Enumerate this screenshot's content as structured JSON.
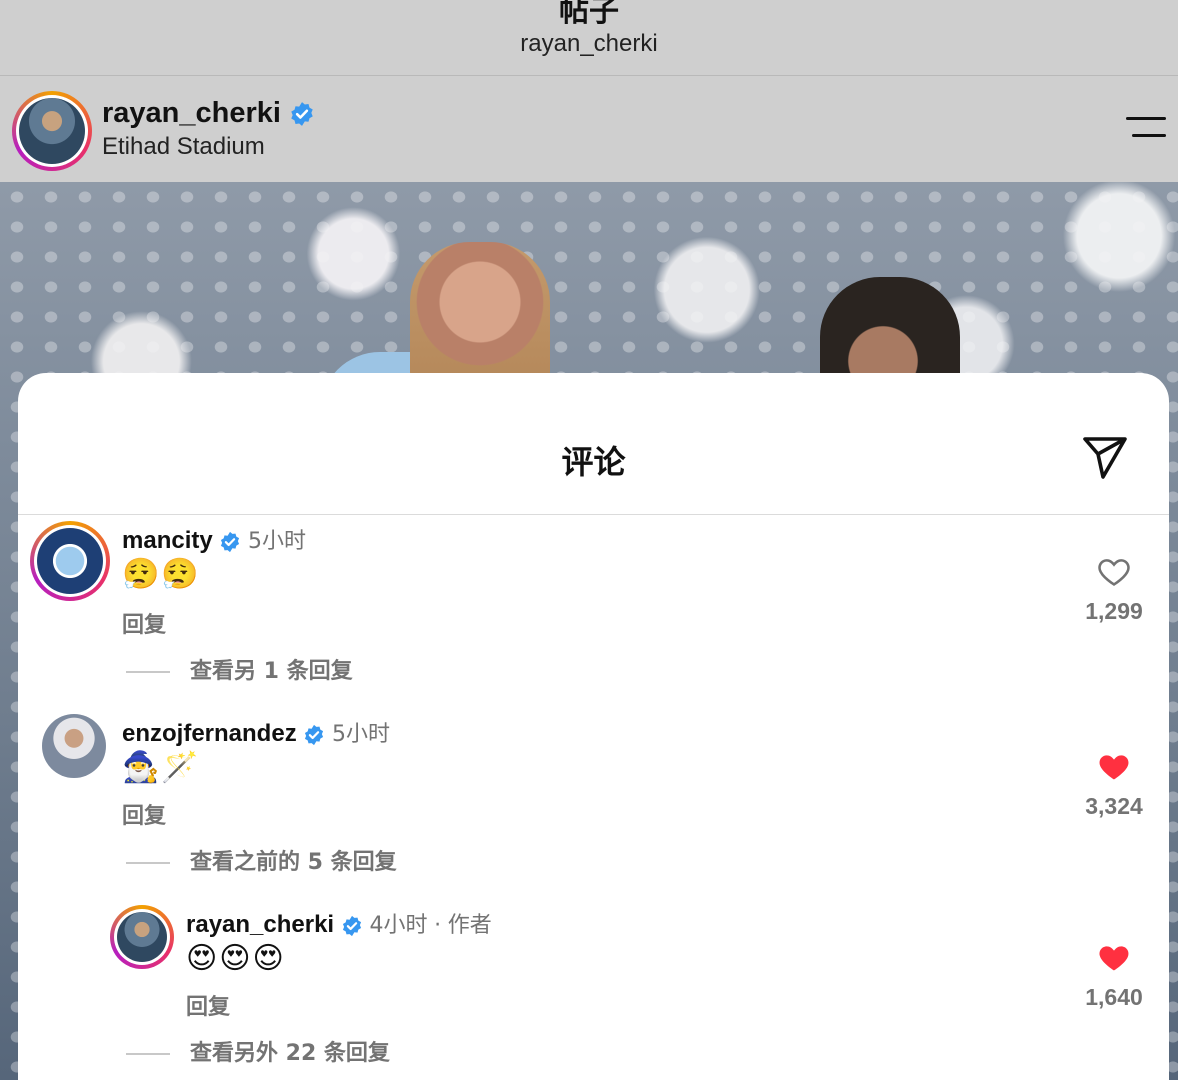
{
  "topbar": {
    "title": "帖子",
    "subtitle": "rayan_cherki"
  },
  "post": {
    "username": "rayan_cherki",
    "location": "Etihad Stadium"
  },
  "comments_sheet": {
    "title": "评论",
    "comments": [
      {
        "username": "mancity",
        "time": "5小时",
        "text": "😮‍💨😮‍💨",
        "reply_label": "回复",
        "likes": "1,299",
        "liked": false,
        "view_replies": "查看另 1 条回复"
      },
      {
        "username": "enzojfernandez",
        "time": "5小时",
        "text": "🧙‍♂️🪄",
        "reply_label": "回复",
        "likes": "3,324",
        "liked": true,
        "view_replies": "查看之前的 5 条回复"
      }
    ],
    "reply": {
      "username": "rayan_cherki",
      "time": "4小时",
      "author_tag": "作者",
      "separator": "·",
      "text": "😍😍😍",
      "reply_label": "回复",
      "likes": "1,640",
      "liked": true,
      "view_replies": "查看另外 22 条回复"
    }
  },
  "colors": {
    "verified": "#3797f0",
    "like_red": "#ff3040",
    "muted": "#737373"
  },
  "icons": [
    "verified-icon",
    "menu-icon",
    "share-icon",
    "heart-outline-icon",
    "heart-filled-icon"
  ]
}
